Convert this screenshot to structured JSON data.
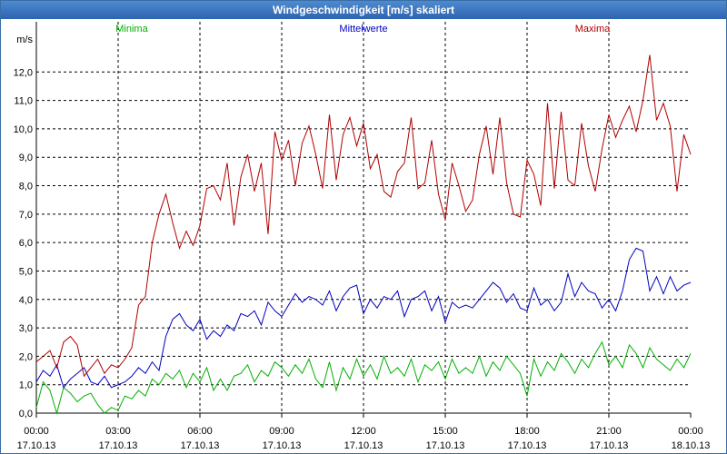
{
  "window": {
    "title": "Windgeschwindigkeit [m/s] skaliert"
  },
  "chart_data": {
    "type": "line",
    "title": "Windgeschwindigkeit [m/s] skaliert",
    "ylabel": "m/s",
    "xlabel": "",
    "ylim": [
      0,
      13.0
    ],
    "yticks": [
      "0,0",
      "1,0",
      "2,0",
      "3,0",
      "4,0",
      "5,0",
      "6,0",
      "7,0",
      "8,0",
      "9,0",
      "10,0",
      "11,0",
      "12,0"
    ],
    "xlim": [
      "17.10.13 00:00",
      "18.10.13 00:00"
    ],
    "xticks": [
      {
        "time": "00:00",
        "date": "17.10.13"
      },
      {
        "time": "03:00",
        "date": "17.10.13"
      },
      {
        "time": "06:00",
        "date": "17.10.13"
      },
      {
        "time": "09:00",
        "date": "17.10.13"
      },
      {
        "time": "12:00",
        "date": "17.10.13"
      },
      {
        "time": "15:00",
        "date": "17.10.13"
      },
      {
        "time": "18:00",
        "date": "17.10.13"
      },
      {
        "time": "21:00",
        "date": "17.10.13"
      },
      {
        "time": "00:00",
        "date": "18.10.13"
      }
    ],
    "grid": true,
    "legend": "top",
    "series": [
      {
        "name": "Minima",
        "color": "#00b000",
        "x": [
          "00:00",
          "00:15",
          "00:30",
          "00:45",
          "01:00",
          "01:15",
          "01:30",
          "01:45",
          "02:00",
          "02:15",
          "02:30",
          "02:45",
          "03:00",
          "03:15",
          "03:30",
          "03:45",
          "04:00",
          "04:15",
          "04:30",
          "04:45",
          "05:00",
          "05:15",
          "05:30",
          "05:45",
          "06:00",
          "06:15",
          "06:30",
          "06:45",
          "07:00",
          "07:15",
          "07:30",
          "07:45",
          "08:00",
          "08:15",
          "08:30",
          "08:45",
          "09:00",
          "09:15",
          "09:30",
          "09:45",
          "10:00",
          "10:15",
          "10:30",
          "10:45",
          "11:00",
          "11:15",
          "11:30",
          "11:45",
          "12:00",
          "12:15",
          "12:30",
          "12:45",
          "13:00",
          "13:15",
          "13:30",
          "13:45",
          "14:00",
          "14:15",
          "14:30",
          "14:45",
          "15:00",
          "15:15",
          "15:30",
          "15:45",
          "16:00",
          "16:15",
          "16:30",
          "16:45",
          "17:00",
          "17:15",
          "17:30",
          "17:45",
          "18:00",
          "18:15",
          "18:30",
          "18:45",
          "19:00",
          "19:15",
          "19:30",
          "19:45",
          "20:00",
          "20:15",
          "20:30",
          "20:45",
          "21:00",
          "21:15",
          "21:30",
          "21:45",
          "22:00",
          "22:15",
          "22:30",
          "22:45",
          "23:00",
          "23:15",
          "23:30",
          "23:45",
          "24:00"
        ],
        "values": [
          0.2,
          1.1,
          0.8,
          0.0,
          0.9,
          0.7,
          0.4,
          0.6,
          0.7,
          0.3,
          0.0,
          0.2,
          0.1,
          0.6,
          0.5,
          0.8,
          0.6,
          1.2,
          1.0,
          1.4,
          1.2,
          1.5,
          0.9,
          1.4,
          1.1,
          1.6,
          0.8,
          1.2,
          0.8,
          1.3,
          1.4,
          1.7,
          1.1,
          1.5,
          1.3,
          1.8,
          1.6,
          1.3,
          1.7,
          1.4,
          1.9,
          1.2,
          0.9,
          1.8,
          0.8,
          1.6,
          1.2,
          1.9,
          1.3,
          1.7,
          1.2,
          2.0,
          1.4,
          1.6,
          1.3,
          1.9,
          1.1,
          1.7,
          1.5,
          1.8,
          1.2,
          1.9,
          1.4,
          1.6,
          1.4,
          2.0,
          1.3,
          1.8,
          1.5,
          2.0,
          1.7,
          1.4,
          0.6,
          1.9,
          1.3,
          1.8,
          1.5,
          2.1,
          1.8,
          1.4,
          1.9,
          1.6,
          2.1,
          2.5,
          1.7,
          2.0,
          1.6,
          2.4,
          2.1,
          1.6,
          2.3,
          1.9,
          1.7,
          1.5,
          1.9,
          1.6,
          2.1
        ]
      },
      {
        "name": "Mittelwerte",
        "color": "#0000c0",
        "x": [
          "00:00",
          "00:15",
          "00:30",
          "00:45",
          "01:00",
          "01:15",
          "01:30",
          "01:45",
          "02:00",
          "02:15",
          "02:30",
          "02:45",
          "03:00",
          "03:15",
          "03:30",
          "03:45",
          "04:00",
          "04:15",
          "04:30",
          "04:45",
          "05:00",
          "05:15",
          "05:30",
          "05:45",
          "06:00",
          "06:15",
          "06:30",
          "06:45",
          "07:00",
          "07:15",
          "07:30",
          "07:45",
          "08:00",
          "08:15",
          "08:30",
          "08:45",
          "09:00",
          "09:15",
          "09:30",
          "09:45",
          "10:00",
          "10:15",
          "10:30",
          "10:45",
          "11:00",
          "11:15",
          "11:30",
          "11:45",
          "12:00",
          "12:15",
          "12:30",
          "12:45",
          "13:00",
          "13:15",
          "13:30",
          "13:45",
          "14:00",
          "14:15",
          "14:30",
          "14:45",
          "15:00",
          "15:15",
          "15:30",
          "15:45",
          "16:00",
          "16:15",
          "16:30",
          "16:45",
          "17:00",
          "17:15",
          "17:30",
          "17:45",
          "18:00",
          "18:15",
          "18:30",
          "18:45",
          "19:00",
          "19:15",
          "19:30",
          "19:45",
          "20:00",
          "20:15",
          "20:30",
          "20:45",
          "21:00",
          "21:15",
          "21:30",
          "21:45",
          "22:00",
          "22:15",
          "22:30",
          "22:45",
          "23:00",
          "23:15",
          "23:30",
          "23:45",
          "24:00"
        ],
        "values": [
          1.1,
          1.5,
          1.3,
          1.7,
          0.9,
          1.2,
          1.4,
          1.6,
          1.1,
          1.0,
          1.3,
          0.9,
          1.0,
          1.1,
          1.3,
          1.6,
          1.4,
          1.8,
          1.5,
          2.7,
          3.3,
          3.5,
          3.1,
          2.9,
          3.3,
          2.6,
          2.9,
          2.7,
          3.1,
          2.9,
          3.5,
          3.4,
          3.6,
          3.1,
          3.9,
          3.6,
          3.4,
          3.8,
          4.2,
          3.9,
          4.1,
          4.0,
          3.8,
          4.3,
          3.6,
          4.1,
          4.4,
          4.5,
          3.5,
          4.0,
          3.7,
          4.1,
          4.0,
          4.3,
          3.4,
          4.0,
          4.1,
          4.3,
          3.6,
          4.1,
          3.2,
          3.9,
          3.7,
          3.8,
          3.7,
          4.0,
          4.3,
          4.6,
          4.4,
          3.9,
          4.2,
          3.7,
          3.6,
          4.4,
          3.8,
          4.0,
          3.6,
          3.9,
          4.9,
          4.1,
          4.6,
          4.3,
          4.2,
          3.7,
          4.0,
          3.6,
          4.3,
          5.4,
          5.8,
          5.7,
          4.3,
          4.8,
          4.2,
          4.8,
          4.3,
          4.5,
          4.6
        ]
      },
      {
        "name": "Maxima",
        "color": "#b00000",
        "x": [
          "00:00",
          "00:15",
          "00:30",
          "00:45",
          "01:00",
          "01:15",
          "01:30",
          "01:45",
          "02:00",
          "02:15",
          "02:30",
          "02:45",
          "03:00",
          "03:15",
          "03:30",
          "03:45",
          "04:00",
          "04:15",
          "04:30",
          "04:45",
          "05:00",
          "05:15",
          "05:30",
          "05:45",
          "06:00",
          "06:15",
          "06:30",
          "06:45",
          "07:00",
          "07:15",
          "07:30",
          "07:45",
          "08:00",
          "08:15",
          "08:30",
          "08:45",
          "09:00",
          "09:15",
          "09:30",
          "09:45",
          "10:00",
          "10:15",
          "10:30",
          "10:45",
          "11:00",
          "11:15",
          "11:30",
          "11:45",
          "12:00",
          "12:15",
          "12:30",
          "12:45",
          "13:00",
          "13:15",
          "13:30",
          "13:45",
          "14:00",
          "14:15",
          "14:30",
          "14:45",
          "15:00",
          "15:15",
          "15:30",
          "15:45",
          "16:00",
          "16:15",
          "16:30",
          "16:45",
          "17:00",
          "17:15",
          "17:30",
          "17:45",
          "18:00",
          "18:15",
          "18:30",
          "18:45",
          "19:00",
          "19:15",
          "19:30",
          "19:45",
          "20:00",
          "20:15",
          "20:30",
          "20:45",
          "21:00",
          "21:15",
          "21:30",
          "21:45",
          "22:00",
          "22:15",
          "22:30",
          "22:45",
          "23:00",
          "23:15",
          "23:30",
          "23:45",
          "24:00"
        ],
        "values": [
          1.8,
          2.0,
          2.2,
          1.6,
          2.5,
          2.7,
          2.4,
          1.3,
          1.6,
          1.9,
          1.4,
          1.7,
          1.6,
          1.9,
          2.3,
          3.8,
          4.1,
          6.0,
          7.0,
          7.7,
          6.7,
          5.8,
          6.4,
          5.9,
          6.6,
          7.9,
          8.0,
          7.5,
          8.8,
          6.6,
          8.3,
          9.1,
          7.8,
          8.8,
          6.3,
          9.9,
          8.9,
          9.6,
          8.0,
          9.5,
          10.1,
          9.1,
          7.9,
          10.5,
          8.2,
          9.8,
          10.4,
          9.4,
          10.2,
          8.6,
          9.1,
          7.8,
          7.6,
          8.5,
          8.8,
          10.4,
          7.9,
          8.1,
          9.6,
          7.7,
          6.8,
          8.8,
          8.0,
          7.1,
          7.5,
          9.1,
          10.1,
          8.4,
          10.4,
          8.1,
          7.0,
          6.9,
          8.9,
          8.4,
          7.3,
          10.9,
          7.9,
          10.6,
          8.2,
          8.0,
          10.2,
          8.7,
          7.8,
          9.3,
          10.5,
          9.7,
          10.3,
          10.8,
          9.9,
          11.0,
          12.6,
          10.3,
          10.9,
          10.1,
          7.8,
          9.8,
          9.1
        ]
      }
    ]
  }
}
